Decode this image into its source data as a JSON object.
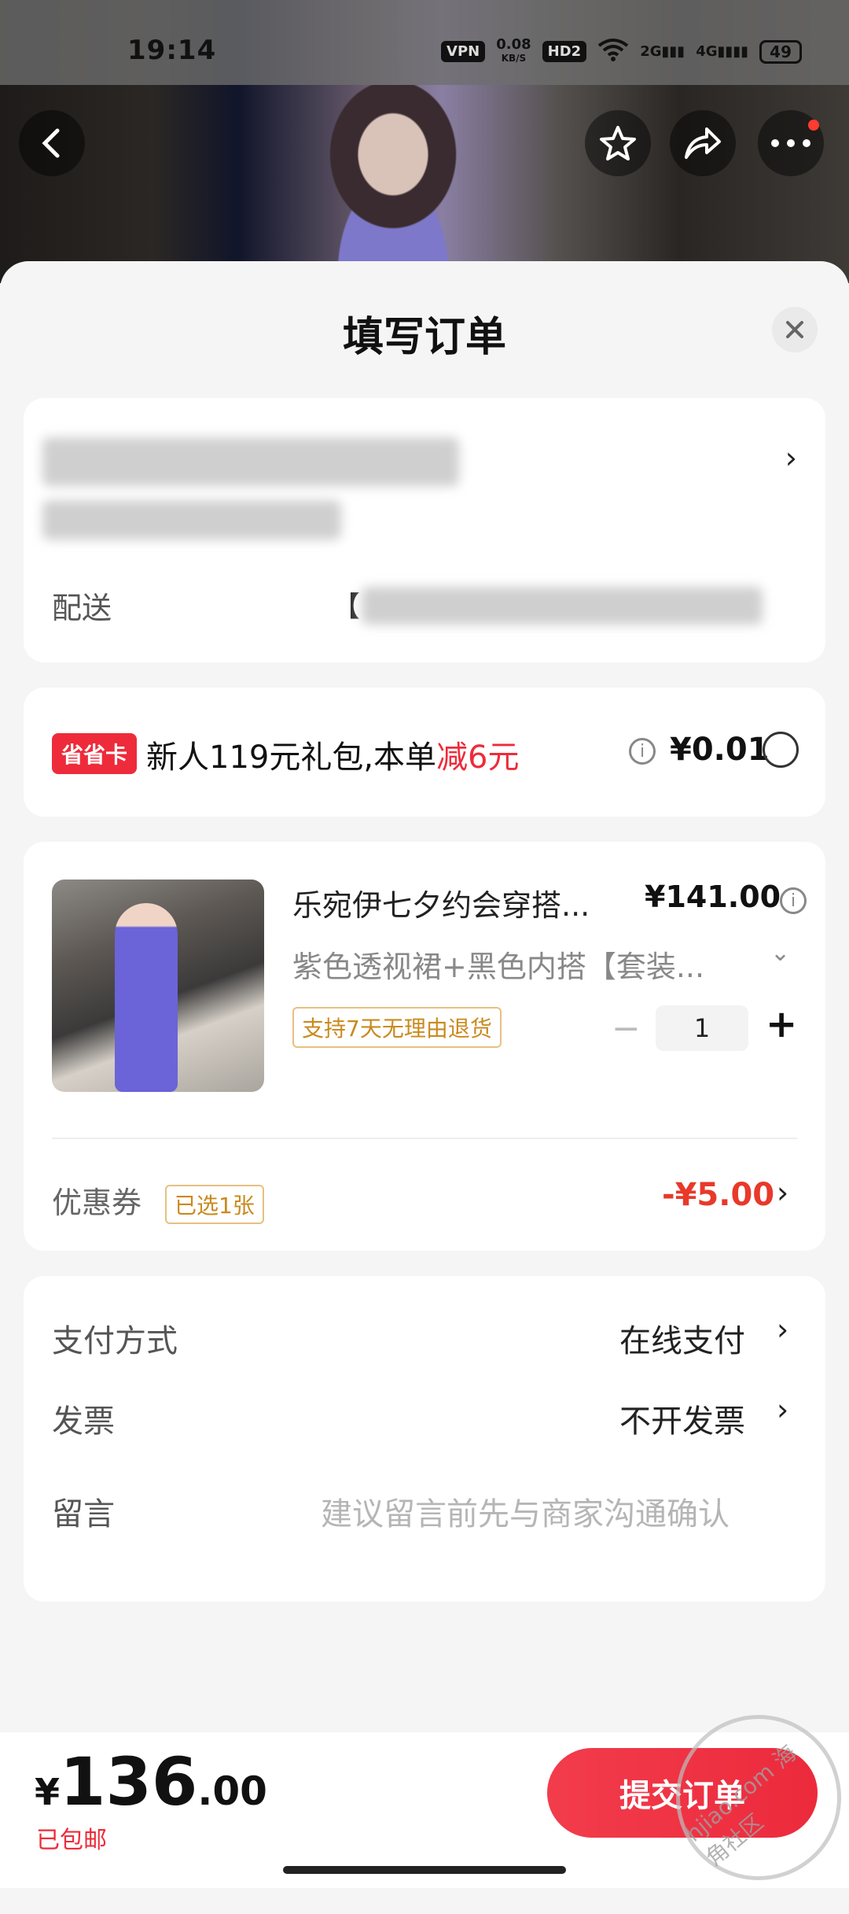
{
  "status_bar": {
    "time": "19:14",
    "vpn": "VPN",
    "speed_value": "0.08",
    "speed_unit": "KB/S",
    "hd": "HD2",
    "net2g": "2G",
    "net4g": "4G",
    "battery": "49"
  },
  "header": {
    "title": "填写订单",
    "close_icon": "close-icon"
  },
  "address": {
    "shipping_label": "配送",
    "shipping_value_prefix": "【"
  },
  "promo": {
    "badge": "省省卡",
    "text_main": "新人119元礼包,本单",
    "text_red": "减6元",
    "price": "¥0.01"
  },
  "product": {
    "title": "乐宛伊七夕约会穿搭...",
    "price": "¥141.00",
    "spec": "紫色透视裙+黑色内搭【套装...",
    "return_tag": "支持7天无理由退货",
    "qty_minus": "−",
    "quantity": "1",
    "qty_plus": "+"
  },
  "coupon": {
    "label": "优惠券",
    "tag": "已选1张",
    "value": "-¥5.00"
  },
  "payment": {
    "pay_label": "支付方式",
    "pay_value": "在线支付",
    "invoice_label": "发票",
    "invoice_value": "不开发票",
    "note_label": "留言",
    "note_placeholder": "建议留言前先与商家沟通确认"
  },
  "footer": {
    "currency": "¥",
    "total_int": "136",
    "total_dec": ".00",
    "free_shipping": "已包邮",
    "submit_label": "提交订单"
  },
  "watermark": "hjiao.com 海角社区",
  "colors": {
    "accent_red": "#ee2b3a",
    "coupon_red": "#e8392a",
    "tag_gold": "#c98a1e"
  }
}
